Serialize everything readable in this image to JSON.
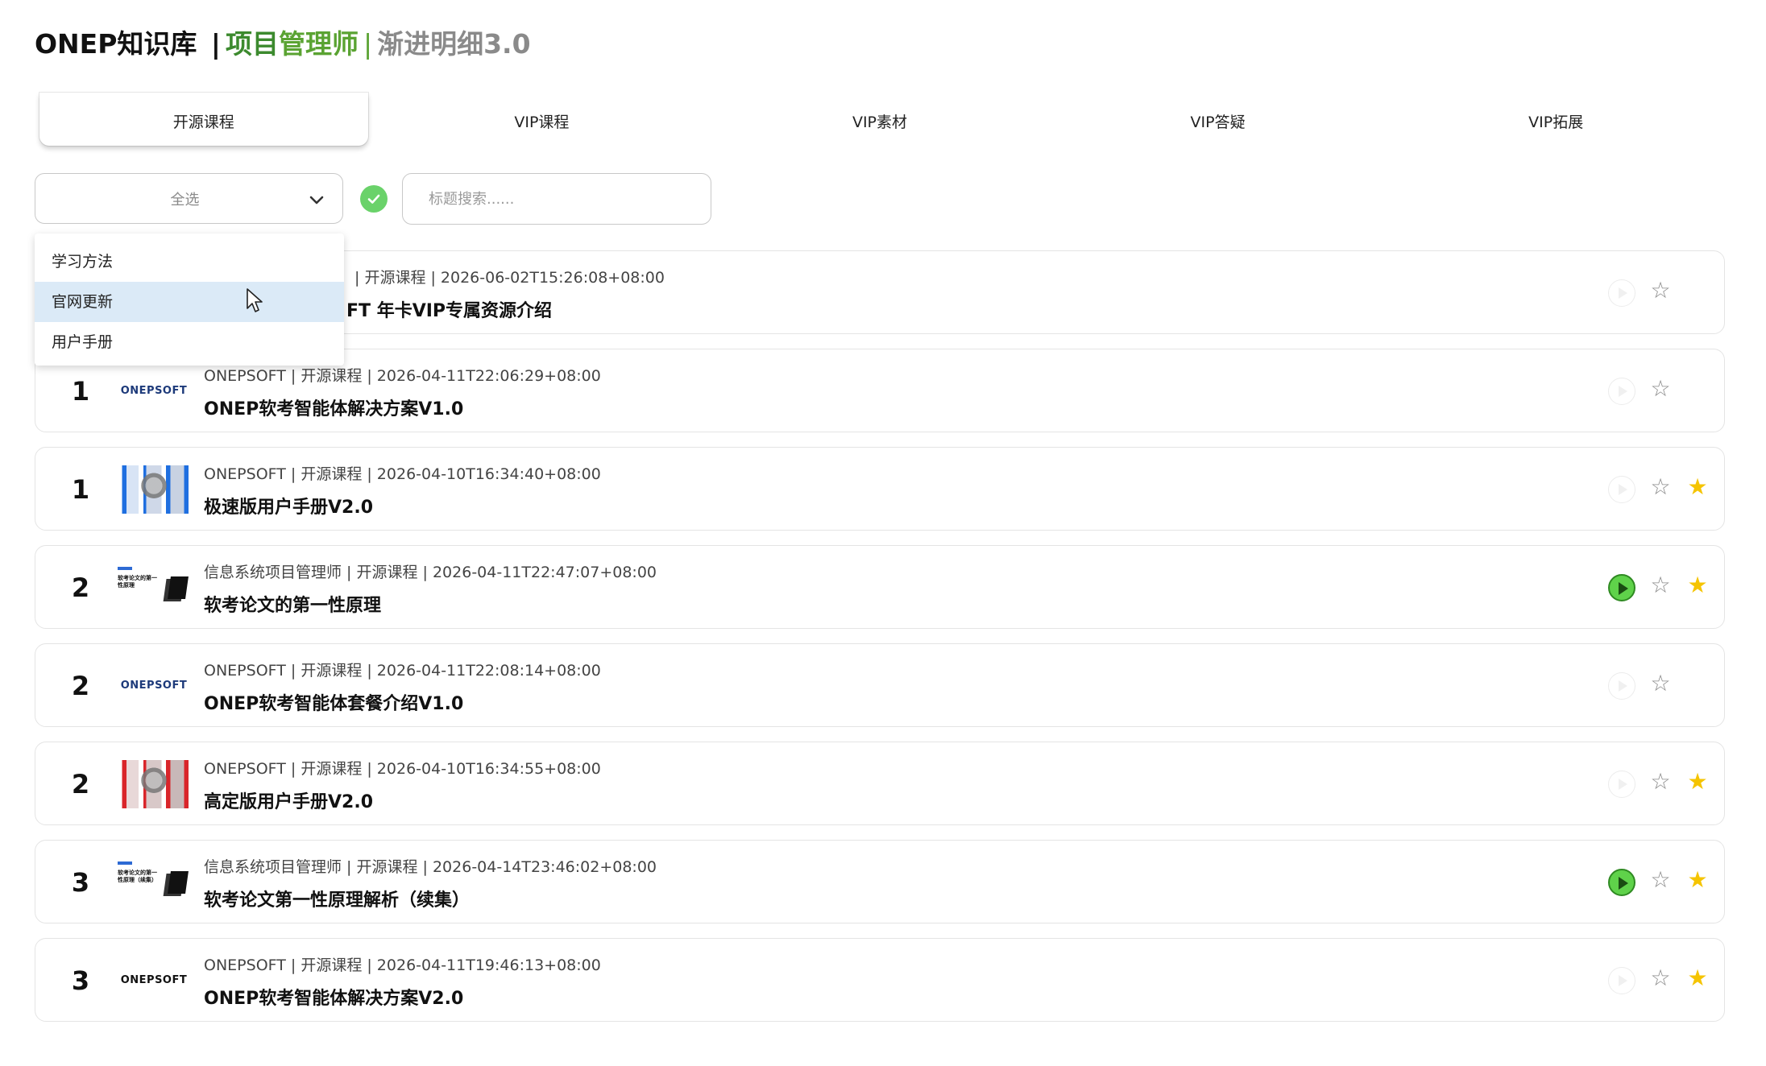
{
  "header": {
    "brand": "ONEP知识库",
    "sep": "|",
    "role_1": "项目",
    "role_2": "管理师",
    "sep2": "|",
    "version": "渐进明细3.0"
  },
  "tabs": [
    {
      "label": "开源课程",
      "active": true
    },
    {
      "label": "VIP课程",
      "active": false
    },
    {
      "label": "VIP素材",
      "active": false
    },
    {
      "label": "VIP答疑",
      "active": false
    },
    {
      "label": "VIP拓展",
      "active": false
    }
  ],
  "filter": {
    "selected": "全选",
    "options": [
      "学习方法",
      "官网更新",
      "用户手册"
    ],
    "hovered_option": "官网更新"
  },
  "search": {
    "placeholder": "标题搜索......",
    "value": ""
  },
  "colors": {
    "accent_green": "#5aa332",
    "star_yellow": "#f5c400",
    "hover_blue": "#dbeaf7"
  },
  "rows": [
    {
      "rank": "",
      "meta": "| 开源课程 | 2026-06-02T15:26:08+08:00",
      "title": "FT 年卡VIP专属资源介绍",
      "thumb": "hidden",
      "playing": false,
      "starred": false
    },
    {
      "rank": "1",
      "meta": "ONEPSOFT | 开源课程 | 2026-04-11T22:06:29+08:00",
      "title": "ONEP软考智能体解决方案V1.0",
      "thumb": "logo",
      "thumb_text": "ONEPSOFT",
      "playing": false,
      "starred": false
    },
    {
      "rank": "1",
      "meta": "ONEPSOFT | 开源课程 | 2026-04-10T16:34:40+08:00",
      "title": "极速版用户手册V2.0",
      "thumb": "art-blue",
      "playing": false,
      "starred": true
    },
    {
      "rank": "2",
      "meta": "信息系统项目管理师 | 开源课程 | 2026-04-11T22:47:07+08:00",
      "title": "软考论文的第一性原理",
      "thumb": "doc",
      "thumb_text": "软考论文的第一性原理",
      "playing": true,
      "starred": true
    },
    {
      "rank": "2",
      "meta": "ONEPSOFT | 开源课程 | 2026-04-11T22:08:14+08:00",
      "title": "ONEP软考智能体套餐介绍V1.0",
      "thumb": "logo",
      "thumb_text": "ONEPSOFT",
      "playing": false,
      "starred": false
    },
    {
      "rank": "2",
      "meta": "ONEPSOFT | 开源课程 | 2026-04-10T16:34:55+08:00",
      "title": "高定版用户手册V2.0",
      "thumb": "art-red",
      "playing": false,
      "starred": true
    },
    {
      "rank": "3",
      "meta": "信息系统项目管理师 | 开源课程 | 2026-04-14T23:46:02+08:00",
      "title": "软考论文第一性原理解析（续集）",
      "thumb": "doc",
      "thumb_text": "软考论文的第一性原理（续集）",
      "playing": true,
      "starred": true
    },
    {
      "rank": "3",
      "meta": "ONEPSOFT | 开源课程 | 2026-04-11T19:46:13+08:00",
      "title": "ONEP软考智能体解决方案V2.0",
      "thumb": "logo-dark",
      "thumb_text": "ONEPSOFT",
      "playing": false,
      "starred": true
    }
  ]
}
